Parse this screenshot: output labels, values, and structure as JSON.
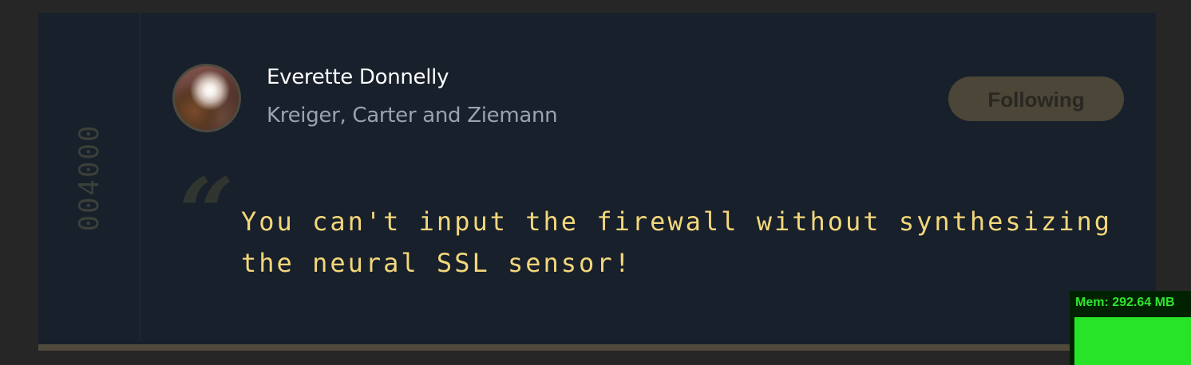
{
  "card": {
    "rail_number": "004000",
    "author": {
      "name": "Everette Donnelly",
      "company": "Kreiger, Carter and Ziemann",
      "avatar": "user-avatar-photo"
    },
    "follow_button": {
      "label": "Following"
    },
    "quote_mark": "“",
    "quote": "You can't input the firewall without synthesizing the neural SSL sensor!"
  },
  "memory_monitor": {
    "label": "Mem: 292.64 MB"
  },
  "colors": {
    "page_background": "#262626",
    "card_background": "#18202b",
    "quote_text": "#f3d77b",
    "button_background": "#4b4637",
    "memory_green": "#28e428"
  }
}
